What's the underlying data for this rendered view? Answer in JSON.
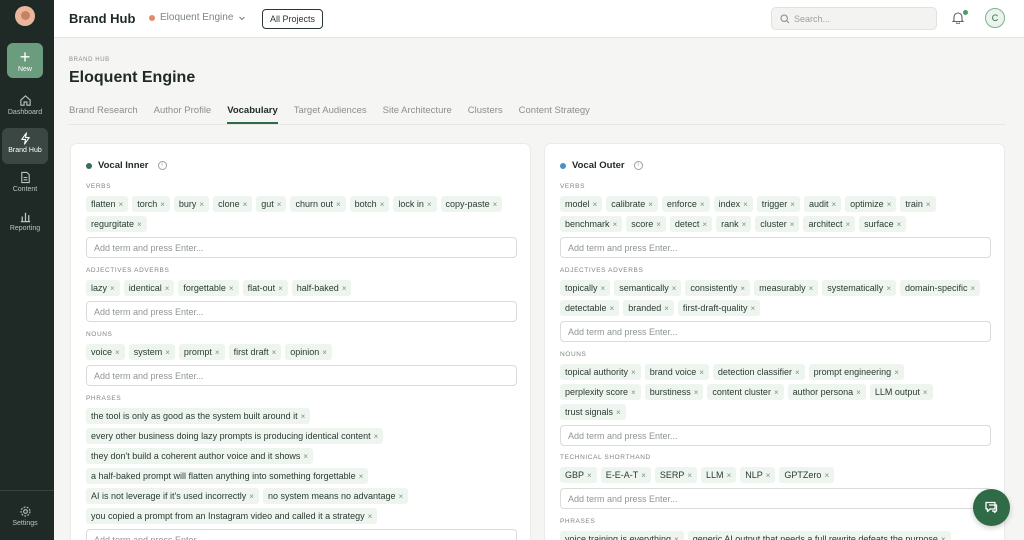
{
  "rail": {
    "new_label": "New",
    "items": [
      {
        "label": "Dashboard",
        "icon": "home-icon"
      },
      {
        "label": "Brand Hub",
        "icon": "bolt-icon"
      },
      {
        "label": "Content",
        "icon": "document-icon"
      },
      {
        "label": "Reporting",
        "icon": "bar-chart-icon"
      }
    ],
    "settings_label": "Settings"
  },
  "topbar": {
    "title": "Brand Hub",
    "project": "Eloquent Engine",
    "all_projects": "All Projects",
    "search_placeholder": "Search...",
    "avatar_initial": "C"
  },
  "header": {
    "overline": "BRAND HUB",
    "title": "Eloquent Engine",
    "tabs": [
      "Brand Research",
      "Author Profile",
      "Vocabulary",
      "Target Audiences",
      "Site Architecture",
      "Clusters",
      "Content Strategy"
    ],
    "active_tab": "Vocabulary"
  },
  "adder_placeholder": "Add term and press Enter...",
  "inner": {
    "title": "Vocal Inner",
    "dot_color": "#3d6b55",
    "sections": [
      {
        "label": "VERBS",
        "terms": [
          "flatten",
          "torch",
          "bury",
          "clone",
          "gut",
          "churn out",
          "botch",
          "lock in",
          "copy-paste",
          "regurgitate"
        ]
      },
      {
        "label": "ADJECTIVES ADVERBS",
        "terms": [
          "lazy",
          "identical",
          "forgettable",
          "flat-out",
          "half-baked"
        ]
      },
      {
        "label": "NOUNS",
        "terms": [
          "voice",
          "system",
          "prompt",
          "first draft",
          "opinion"
        ]
      },
      {
        "label": "PHRASES",
        "terms": [
          "the tool is only as good as the system built around it",
          "every other business doing lazy prompts is producing identical content",
          "they don't build a coherent author voice and it shows",
          "a half-baked prompt will flatten anything into something forgettable",
          "AI is not leverage if it's used incorrectly",
          "no system means no advantage",
          "you copied a prompt from an Instagram video and called it a strategy"
        ]
      }
    ]
  },
  "outer": {
    "title": "Vocal Outer",
    "dot_color": "#4a8fc7",
    "sections": [
      {
        "label": "VERBS",
        "terms": [
          "model",
          "calibrate",
          "enforce",
          "index",
          "trigger",
          "audit",
          "optimize",
          "train",
          "benchmark",
          "score",
          "detect",
          "rank",
          "cluster",
          "architect",
          "surface"
        ]
      },
      {
        "label": "ADJECTIVES ADVERBS",
        "terms": [
          "topically",
          "semantically",
          "consistently",
          "measurably",
          "systematically",
          "domain-specific",
          "detectable",
          "branded",
          "first-draft-quality"
        ]
      },
      {
        "label": "NOUNS",
        "terms": [
          "topical authority",
          "brand voice",
          "detection classifier",
          "prompt engineering",
          "perplexity score",
          "burstiness",
          "content cluster",
          "author persona",
          "LLM output",
          "trust signals"
        ]
      },
      {
        "label": "TECHNICAL SHORTHAND",
        "terms": [
          "GBP",
          "E-E-A-T",
          "SERP",
          "LLM",
          "NLP",
          "GPTZero"
        ]
      },
      {
        "label": "PHRASES",
        "terms": [
          "voice training is everything",
          "generic AI output that needs a full rewrite defeats the purpose"
        ]
      }
    ]
  }
}
